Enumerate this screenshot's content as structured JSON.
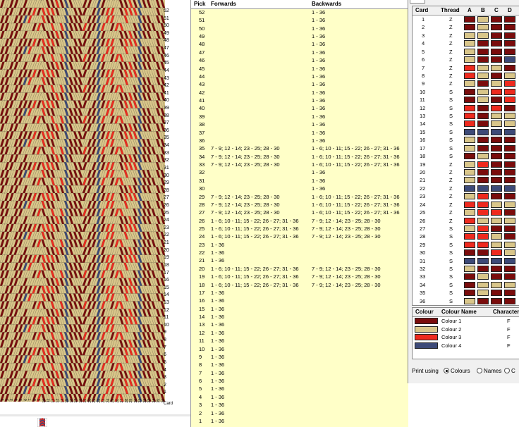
{
  "colors": {
    "c1": "#7a0c0c",
    "c2": "#d9c68a",
    "c3": "#ee2a1e",
    "c4": "#3d4a78",
    "panel_bg": "#ffffc8"
  },
  "pattern_table": {
    "headers": {
      "pick": "Pick",
      "forwards": "Forwards",
      "backwards": "Backwards"
    },
    "rows": [
      {
        "pick": "52",
        "fwd": "",
        "bwd": "1 - 36"
      },
      {
        "pick": "51",
        "fwd": "",
        "bwd": "1 - 36"
      },
      {
        "pick": "50",
        "fwd": "",
        "bwd": "1 - 36"
      },
      {
        "pick": "49",
        "fwd": "",
        "bwd": "1 - 36"
      },
      {
        "pick": "48",
        "fwd": "",
        "bwd": "1 - 36"
      },
      {
        "pick": "47",
        "fwd": "",
        "bwd": "1 - 36"
      },
      {
        "pick": "46",
        "fwd": "",
        "bwd": "1 - 36"
      },
      {
        "pick": "45",
        "fwd": "",
        "bwd": "1 - 36"
      },
      {
        "pick": "44",
        "fwd": "",
        "bwd": "1 - 36"
      },
      {
        "pick": "43",
        "fwd": "",
        "bwd": "1 - 36"
      },
      {
        "pick": "42",
        "fwd": "",
        "bwd": "1 - 36"
      },
      {
        "pick": "41",
        "fwd": "",
        "bwd": "1 - 36"
      },
      {
        "pick": "40",
        "fwd": "",
        "bwd": "1 - 36"
      },
      {
        "pick": "39",
        "fwd": "",
        "bwd": "1 - 36"
      },
      {
        "pick": "38",
        "fwd": "",
        "bwd": "1 - 36"
      },
      {
        "pick": "37",
        "fwd": "",
        "bwd": "1 - 36"
      },
      {
        "pick": "36",
        "fwd": "",
        "bwd": "1 - 36"
      },
      {
        "pick": "35",
        "fwd": "7 - 9; 12 - 14; 23 - 25; 28 - 30",
        "bwd": "1 - 6; 10 - 11; 15 - 22; 26 - 27; 31 - 36"
      },
      {
        "pick": "34",
        "fwd": "7 - 9; 12 - 14; 23 - 25; 28 - 30",
        "bwd": "1 - 6; 10 - 11; 15 - 22; 26 - 27; 31 - 36"
      },
      {
        "pick": "33",
        "fwd": "7 - 9; 12 - 14; 23 - 25; 28 - 30",
        "bwd": "1 - 6; 10 - 11; 15 - 22; 26 - 27; 31 - 36"
      },
      {
        "pick": "32",
        "fwd": "",
        "bwd": "1 - 36"
      },
      {
        "pick": "31",
        "fwd": "",
        "bwd": "1 - 36"
      },
      {
        "pick": "30",
        "fwd": "",
        "bwd": "1 - 36"
      },
      {
        "pick": "29",
        "fwd": "7 - 9; 12 - 14; 23 - 25; 28 - 30",
        "bwd": "1 - 6; 10 - 11; 15 - 22; 26 - 27; 31 - 36"
      },
      {
        "pick": "28",
        "fwd": "7 - 9; 12 - 14; 23 - 25; 28 - 30",
        "bwd": "1 - 6; 10 - 11; 15 - 22; 26 - 27; 31 - 36"
      },
      {
        "pick": "27",
        "fwd": "7 - 9; 12 - 14; 23 - 25; 28 - 30",
        "bwd": "1 - 6; 10 - 11; 15 - 22; 26 - 27; 31 - 36"
      },
      {
        "pick": "26",
        "fwd": "1 - 6; 10 - 11; 15 - 22; 26 - 27; 31 - 36",
        "bwd": "7 - 9; 12 - 14; 23 - 25; 28 - 30"
      },
      {
        "pick": "25",
        "fwd": "1 - 6; 10 - 11; 15 - 22; 26 - 27; 31 - 36",
        "bwd": "7 - 9; 12 - 14; 23 - 25; 28 - 30"
      },
      {
        "pick": "24",
        "fwd": "1 - 6; 10 - 11; 15 - 22; 26 - 27; 31 - 36",
        "bwd": "7 - 9; 12 - 14; 23 - 25; 28 - 30"
      },
      {
        "pick": "23",
        "fwd": "1 - 36",
        "bwd": ""
      },
      {
        "pick": "22",
        "fwd": "1 - 36",
        "bwd": ""
      },
      {
        "pick": "21",
        "fwd": "1 - 36",
        "bwd": ""
      },
      {
        "pick": "20",
        "fwd": "1 - 6; 10 - 11; 15 - 22; 26 - 27; 31 - 36",
        "bwd": "7 - 9; 12 - 14; 23 - 25; 28 - 30"
      },
      {
        "pick": "19",
        "fwd": "1 - 6; 10 - 11; 15 - 22; 26 - 27; 31 - 36",
        "bwd": "7 - 9; 12 - 14; 23 - 25; 28 - 30"
      },
      {
        "pick": "18",
        "fwd": "1 - 6; 10 - 11; 15 - 22; 26 - 27; 31 - 36",
        "bwd": "7 - 9; 12 - 14; 23 - 25; 28 - 30"
      },
      {
        "pick": "17",
        "fwd": "1 - 36",
        "bwd": ""
      },
      {
        "pick": "16",
        "fwd": "1 - 36",
        "bwd": ""
      },
      {
        "pick": "15",
        "fwd": "1 - 36",
        "bwd": ""
      },
      {
        "pick": "14",
        "fwd": "1 - 36",
        "bwd": ""
      },
      {
        "pick": "13",
        "fwd": "1 - 36",
        "bwd": ""
      },
      {
        "pick": "12",
        "fwd": "1 - 36",
        "bwd": ""
      },
      {
        "pick": "11",
        "fwd": "1 - 36",
        "bwd": ""
      },
      {
        "pick": "10",
        "fwd": "1 - 36",
        "bwd": ""
      },
      {
        "pick": "9",
        "fwd": "1 - 36",
        "bwd": ""
      },
      {
        "pick": "8",
        "fwd": "1 - 36",
        "bwd": ""
      },
      {
        "pick": "7",
        "fwd": "1 - 36",
        "bwd": ""
      },
      {
        "pick": "6",
        "fwd": "1 - 36",
        "bwd": ""
      },
      {
        "pick": "5",
        "fwd": "1 - 36",
        "bwd": ""
      },
      {
        "pick": "4",
        "fwd": "1 - 36",
        "bwd": ""
      },
      {
        "pick": "3",
        "fwd": "1 - 36",
        "bwd": ""
      },
      {
        "pick": "2",
        "fwd": "1 - 36",
        "bwd": ""
      },
      {
        "pick": "1",
        "fwd": "1 - 36",
        "bwd": ""
      }
    ]
  },
  "card_table": {
    "headers": {
      "card": "Card",
      "thread": "Thread",
      "a": "A",
      "b": "B",
      "c": "C",
      "d": "D"
    },
    "rows": [
      {
        "card": "1",
        "thread": "Z",
        "holes": [
          1,
          2,
          1,
          1
        ]
      },
      {
        "card": "2",
        "thread": "Z",
        "holes": [
          1,
          2,
          1,
          1
        ]
      },
      {
        "card": "3",
        "thread": "Z",
        "holes": [
          2,
          2,
          1,
          1
        ]
      },
      {
        "card": "4",
        "thread": "Z",
        "holes": [
          2,
          1,
          1,
          1
        ]
      },
      {
        "card": "5",
        "thread": "Z",
        "holes": [
          2,
          1,
          1,
          1
        ]
      },
      {
        "card": "6",
        "thread": "Z",
        "holes": [
          2,
          1,
          1,
          4
        ]
      },
      {
        "card": "7",
        "thread": "Z",
        "holes": [
          3,
          2,
          2,
          1
        ]
      },
      {
        "card": "8",
        "thread": "Z",
        "holes": [
          3,
          2,
          1,
          2
        ]
      },
      {
        "card": "9",
        "thread": "Z",
        "holes": [
          2,
          1,
          2,
          3
        ]
      },
      {
        "card": "10",
        "thread": "S",
        "holes": [
          1,
          2,
          3,
          3
        ]
      },
      {
        "card": "11",
        "thread": "S",
        "holes": [
          1,
          2,
          1,
          3
        ]
      },
      {
        "card": "12",
        "thread": "S",
        "holes": [
          3,
          1,
          3,
          1
        ]
      },
      {
        "card": "13",
        "thread": "S",
        "holes": [
          3,
          1,
          2,
          2
        ]
      },
      {
        "card": "14",
        "thread": "S",
        "holes": [
          3,
          1,
          2,
          2
        ]
      },
      {
        "card": "15",
        "thread": "S",
        "holes": [
          4,
          4,
          4,
          4
        ]
      },
      {
        "card": "16",
        "thread": "S",
        "holes": [
          2,
          1,
          1,
          1
        ]
      },
      {
        "card": "17",
        "thread": "S",
        "holes": [
          2,
          1,
          1,
          1
        ]
      },
      {
        "card": "18",
        "thread": "S",
        "holes": [
          1,
          2,
          1,
          1
        ]
      },
      {
        "card": "19",
        "thread": "Z",
        "holes": [
          2,
          3,
          1,
          1
        ]
      },
      {
        "card": "20",
        "thread": "Z",
        "holes": [
          2,
          1,
          1,
          1
        ]
      },
      {
        "card": "21",
        "thread": "Z",
        "holes": [
          2,
          1,
          1,
          1
        ]
      },
      {
        "card": "22",
        "thread": "Z",
        "holes": [
          4,
          4,
          4,
          4
        ]
      },
      {
        "card": "23",
        "thread": "Z",
        "holes": [
          2,
          3,
          1,
          1
        ]
      },
      {
        "card": "24",
        "thread": "Z",
        "holes": [
          3,
          3,
          2,
          2
        ]
      },
      {
        "card": "25",
        "thread": "Z",
        "holes": [
          2,
          3,
          3,
          1
        ]
      },
      {
        "card": "26",
        "thread": "Z",
        "holes": [
          3,
          2,
          2,
          2
        ]
      },
      {
        "card": "27",
        "thread": "S",
        "holes": [
          2,
          3,
          1,
          1
        ]
      },
      {
        "card": "28",
        "thread": "S",
        "holes": [
          3,
          3,
          2,
          1
        ]
      },
      {
        "card": "29",
        "thread": "S",
        "holes": [
          3,
          3,
          2,
          2
        ]
      },
      {
        "card": "30",
        "thread": "S",
        "holes": [
          1,
          1,
          3,
          2
        ]
      },
      {
        "card": "31",
        "thread": "S",
        "holes": [
          4,
          4,
          4,
          4
        ]
      },
      {
        "card": "32",
        "thread": "S",
        "holes": [
          2,
          1,
          1,
          1
        ]
      },
      {
        "card": "33",
        "thread": "S",
        "holes": [
          1,
          2,
          1,
          1
        ]
      },
      {
        "card": "34",
        "thread": "S",
        "holes": [
          1,
          2,
          2,
          2
        ]
      },
      {
        "card": "35",
        "thread": "S",
        "holes": [
          1,
          2,
          1,
          1
        ]
      },
      {
        "card": "36",
        "thread": "S",
        "holes": [
          2,
          1,
          1,
          1
        ]
      }
    ]
  },
  "color_table": {
    "headers": {
      "colour": "Colour",
      "colour_name": "Colour Name",
      "character": "Character"
    },
    "rows": [
      {
        "color": "#7a0c0c",
        "name": "Colour 1",
        "char": "F"
      },
      {
        "color": "#d9c68a",
        "name": "Colour 2",
        "char": "F"
      },
      {
        "color": "#ee2a1e",
        "name": "Colour 3",
        "char": "F"
      },
      {
        "color": "#3d4a78",
        "name": "Colour 4",
        "char": "F"
      }
    ]
  },
  "print_options": {
    "label": "Print using",
    "colours": "Colours",
    "names": "Names",
    "third": "C"
  },
  "weave_row_numbers": [
    "52",
    "51",
    "50",
    "49",
    "48",
    "47",
    "46",
    "45",
    "44",
    "43",
    "42",
    "41",
    "40",
    "39",
    "38",
    "37",
    "36",
    "35",
    "34",
    "33",
    "32",
    "31",
    "30",
    "29",
    "28",
    "27",
    "26",
    "25",
    "24",
    "23",
    "22",
    "21",
    "20",
    "19",
    "18",
    "17",
    "16",
    "15",
    "14",
    "13",
    "12",
    "11",
    "10",
    "9",
    "8",
    "7",
    "6",
    "5",
    "4",
    "3",
    "2",
    "1"
  ],
  "card_numbers": [
    "1",
    "2",
    "3",
    "4",
    "5",
    "6",
    "7",
    "8",
    "9",
    "10",
    "11",
    "12",
    "13",
    "14",
    "15",
    "16",
    "17",
    "18",
    "19",
    "20",
    "21",
    "22",
    "23",
    "24",
    "25",
    "26",
    "27",
    "28",
    "29",
    "30",
    "31",
    "32",
    "33",
    "34",
    "35",
    "36"
  ],
  "card_axis_label": "Card"
}
